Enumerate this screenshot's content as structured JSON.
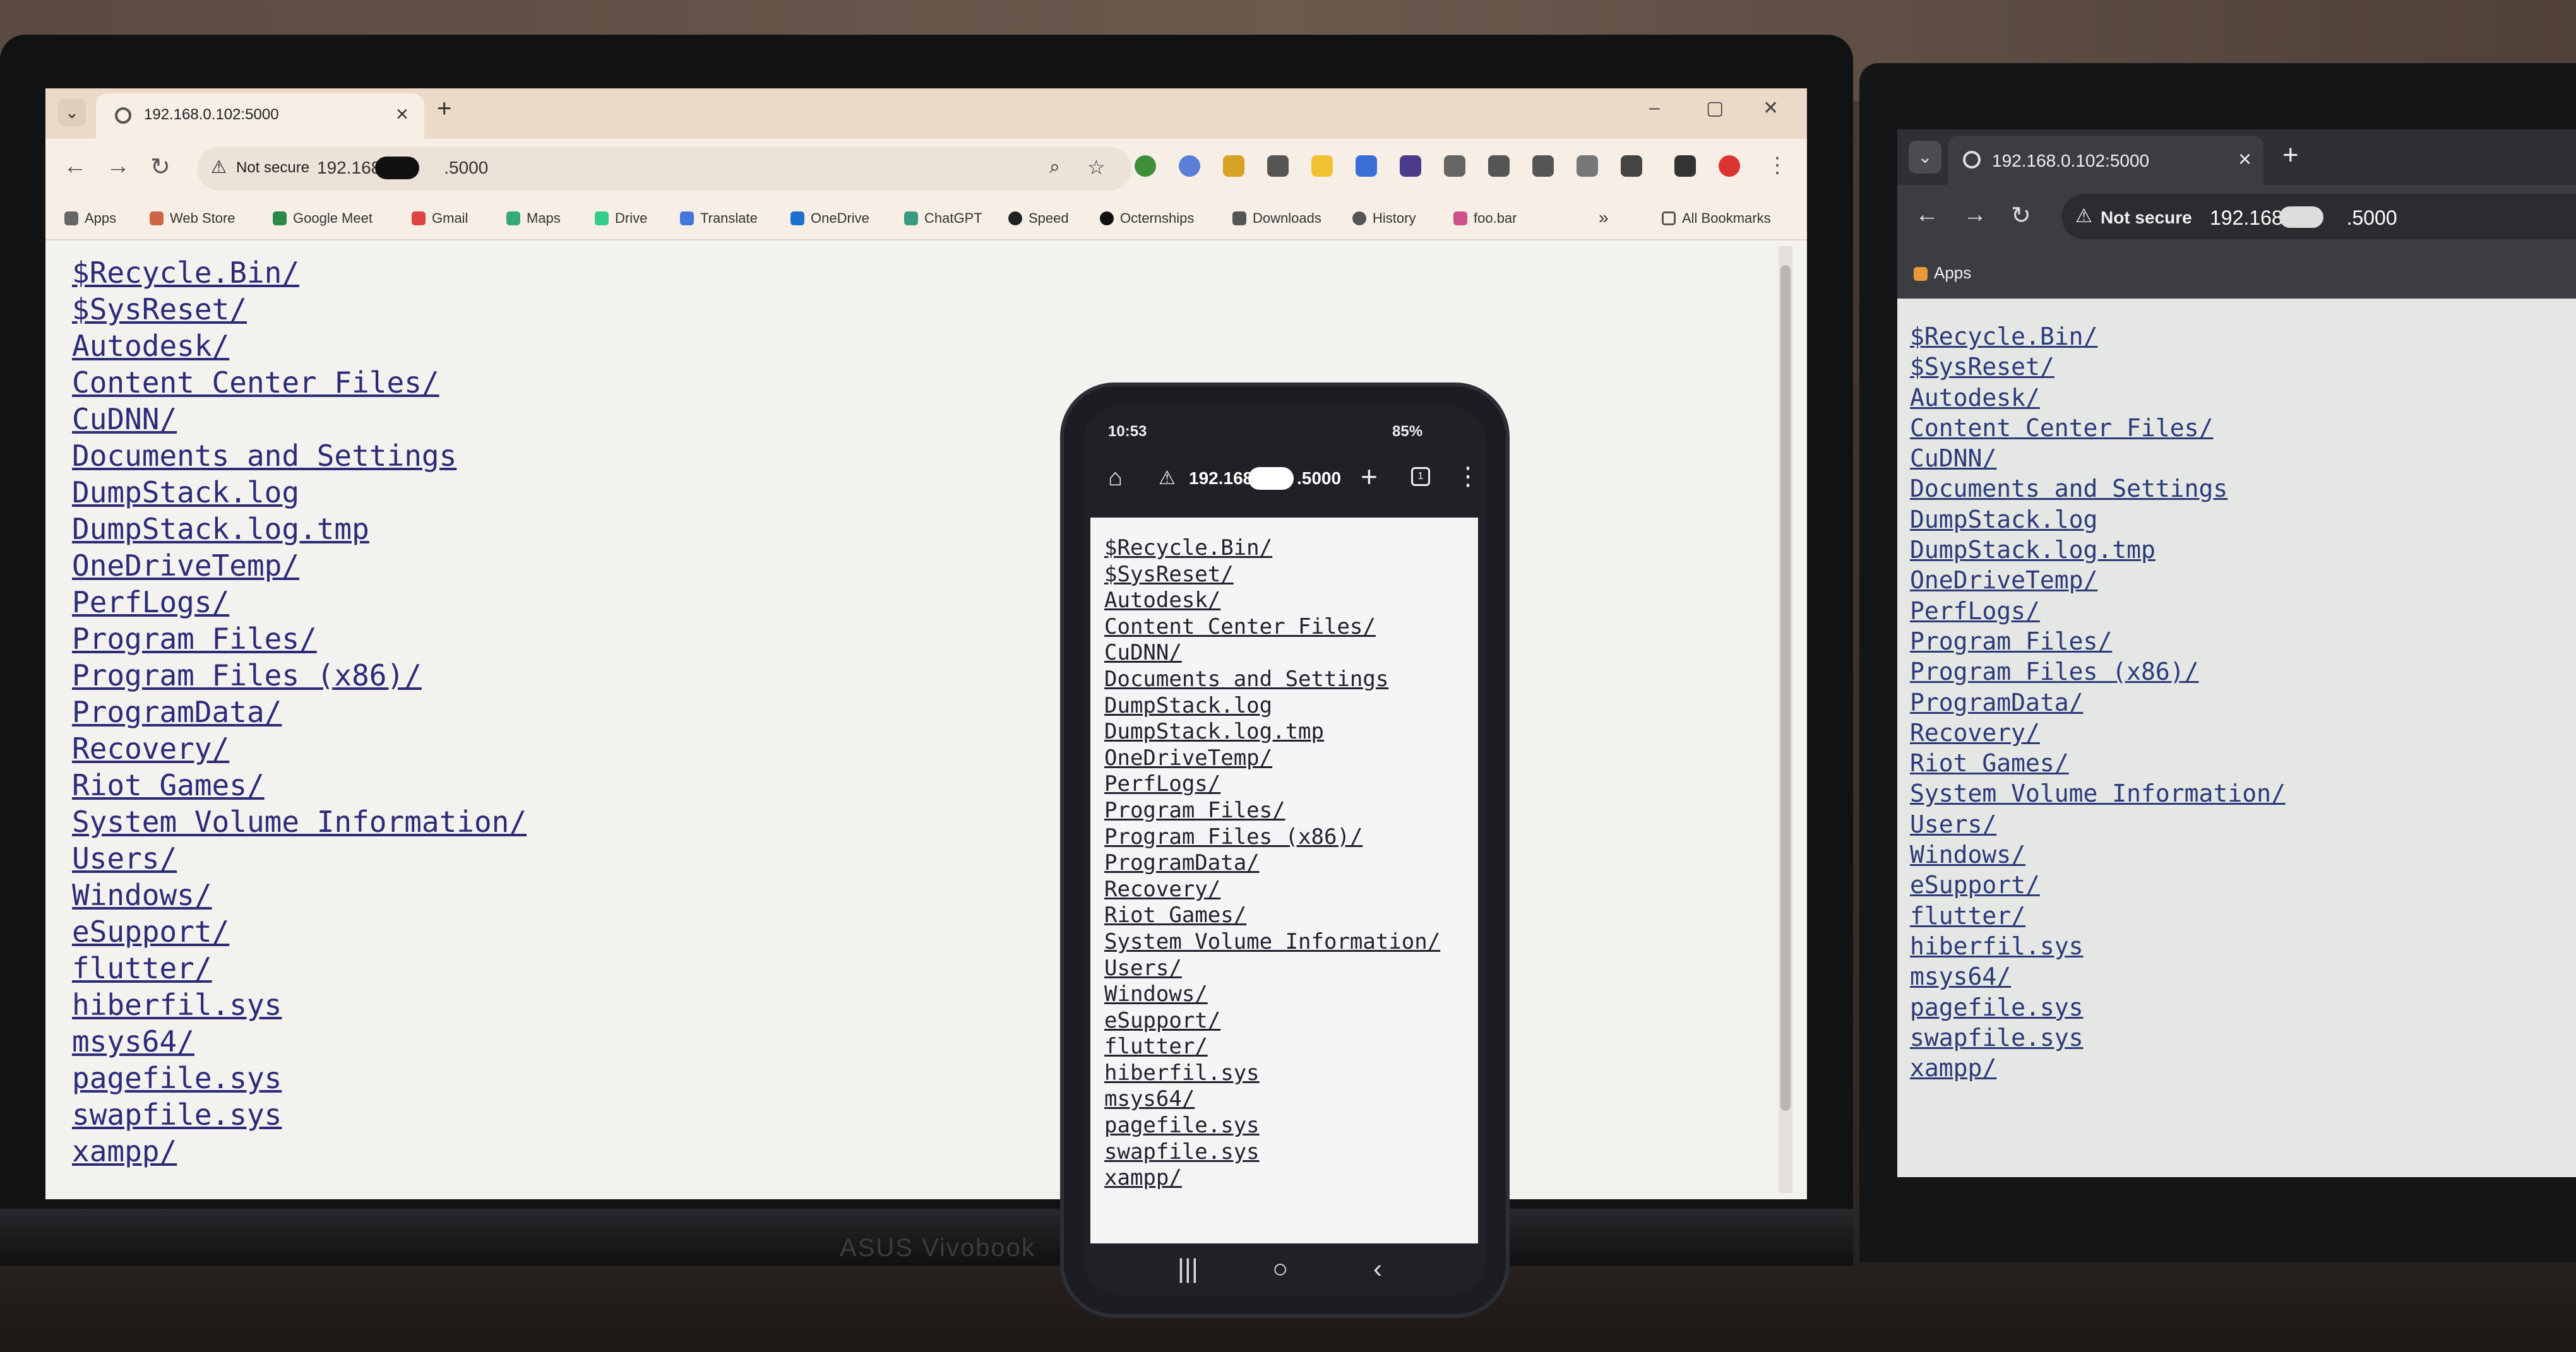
{
  "browser_left": {
    "tab_title": "192.168.0.102:5000",
    "tab_close": "×",
    "new_tab": "+",
    "tab_dropdown": "⌄",
    "window_controls": [
      "–",
      "▢",
      "✕"
    ],
    "nav": [
      "←",
      "→",
      "↻"
    ],
    "security_label": "Not secure",
    "url_start": "192.168",
    "url_end": ".5000",
    "bookmarks": [
      "Apps",
      "Web Store",
      "Google Meet",
      "Gmail",
      "Maps",
      "Drive",
      "Translate",
      "OneDrive",
      "ChatGPT",
      "Speed",
      "Octernships",
      "Downloads",
      "History",
      "foo.bar"
    ],
    "bookmarks_overflow": "»",
    "all_bookmarks": "All Bookmarks",
    "listing": [
      "$Recycle.Bin/",
      "$SysReset/",
      "Autodesk/",
      "Content Center Files/",
      "CuDNN/",
      "Documents and Settings",
      "DumpStack.log",
      "DumpStack.log.tmp",
      "OneDriveTemp/",
      "PerfLogs/",
      "Program Files/",
      "Program Files (x86)/",
      "ProgramData/",
      "Recovery/",
      "Riot Games/",
      "System Volume Information/",
      "Users/",
      "Windows/",
      "eSupport/",
      "flutter/",
      "hiberfil.sys",
      "msys64/",
      "pagefile.sys",
      "swapfile.sys",
      "xampp/"
    ]
  },
  "laptop_brand": "ASUS Vivobook",
  "phone": {
    "time": "10:53",
    "battery": "85%",
    "url_start": "192.168.",
    "url_end": ".5000",
    "tab_count": "1",
    "listing": [
      "$Recycle.Bin/",
      "$SysReset/",
      "Autodesk/",
      "Content Center Files/",
      "CuDNN/",
      "Documents and Settings",
      "DumpStack.log",
      "DumpStack.log.tmp",
      "OneDriveTemp/",
      "PerfLogs/",
      "Program Files/",
      "Program Files (x86)/",
      "ProgramData/",
      "Recovery/",
      "Riot Games/",
      "System Volume Information/",
      "Users/",
      "Windows/",
      "eSupport/",
      "flutter/",
      "hiberfil.sys",
      "msys64/",
      "pagefile.sys",
      "swapfile.sys",
      "xampp/"
    ]
  },
  "browser_right": {
    "tab_title": "192.168.0.102:5000",
    "tab_close": "×",
    "new_tab": "+",
    "security_label": "Not secure",
    "url_start": "192.168.",
    "url_end": ".5000",
    "bookmarks": [
      "Apps"
    ],
    "listing": [
      "$Recycle.Bin/",
      "$SysReset/",
      "Autodesk/",
      "Content Center Files/",
      "CuDNN/",
      "Documents and Settings",
      "DumpStack.log",
      "DumpStack.log.tmp",
      "OneDriveTemp/",
      "PerfLogs/",
      "Program Files/",
      "Program Files (x86)/",
      "ProgramData/",
      "Recovery/",
      "Riot Games/",
      "System Volume Information/",
      "Users/",
      "Windows/",
      "eSupport/",
      "flutter/",
      "hiberfil.sys",
      "msys64/",
      "pagefile.sys",
      "swapfile.sys",
      "xampp/"
    ]
  },
  "colors": {
    "link_left": "#2b2b78",
    "link_right": "#2c3a7a",
    "chrome_light": "#f7efe6",
    "chrome_dark": "#3b3d42"
  }
}
